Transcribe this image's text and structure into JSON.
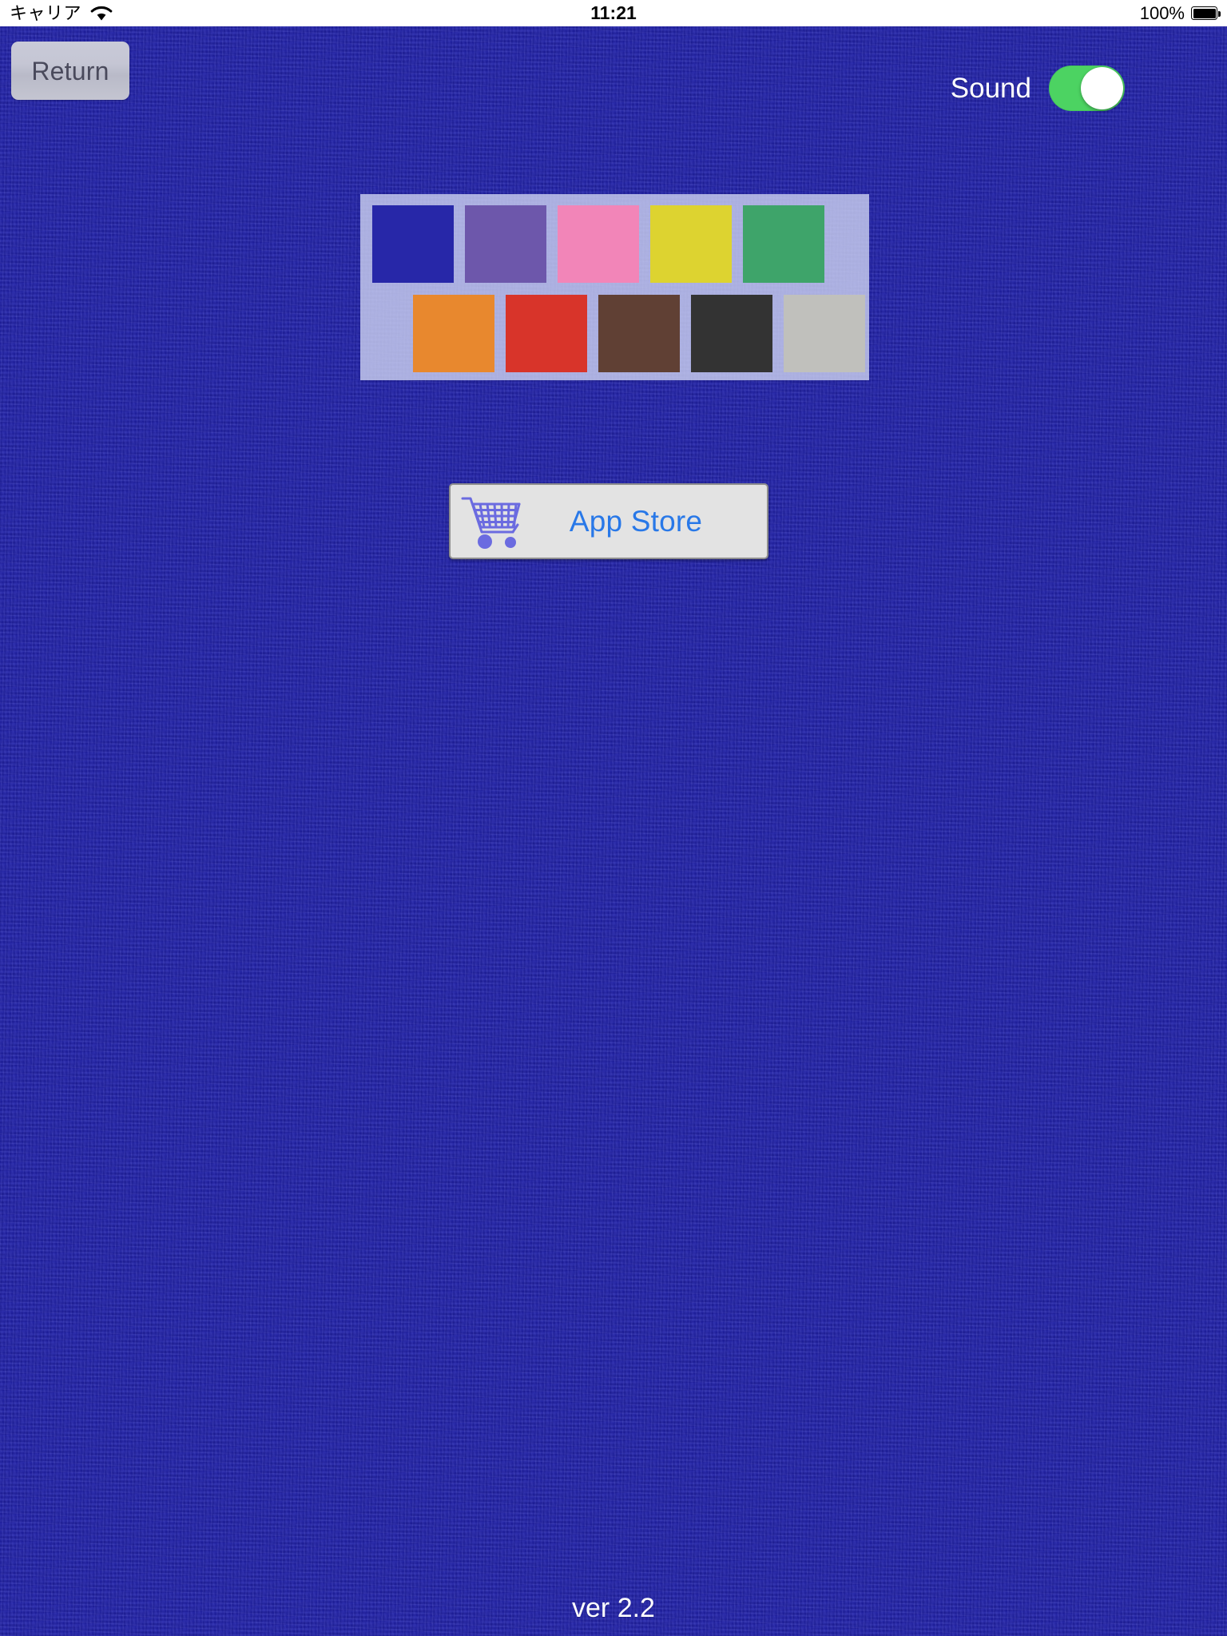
{
  "status_bar": {
    "carrier": "キャリア",
    "wifi_icon": "wifi-icon",
    "time": "11:21",
    "battery_percent": "100%",
    "battery_icon": "battery-full-icon"
  },
  "toolbar": {
    "return_label": "Return",
    "sound_label": "Sound",
    "sound_on": true,
    "sound_switch_color": "#4cd362",
    "sound_knob_color": "#ffffff"
  },
  "palette": {
    "panel_background": "#cdd2f0",
    "swatches_top": [
      {
        "name": "blue",
        "color": "#2727a8"
      },
      {
        "name": "purple",
        "color": "#6d57ab"
      },
      {
        "name": "pink",
        "color": "#f285b8"
      },
      {
        "name": "yellow",
        "color": "#ddd330"
      },
      {
        "name": "green",
        "color": "#3ea46a"
      }
    ],
    "swatches_bottom": [
      {
        "name": "orange",
        "color": "#e8882e"
      },
      {
        "name": "red",
        "color": "#d8342a"
      },
      {
        "name": "brown",
        "color": "#604034"
      },
      {
        "name": "black",
        "color": "#333333"
      },
      {
        "name": "gray",
        "color": "#c0c0bc"
      }
    ]
  },
  "app_store": {
    "label": "App Store",
    "icon": "shopping-cart-icon",
    "icon_color": "#6b6be0",
    "label_color": "#2878e8"
  },
  "footer": {
    "version": "ver 2.2"
  },
  "theme": {
    "background": "#2222a8"
  }
}
